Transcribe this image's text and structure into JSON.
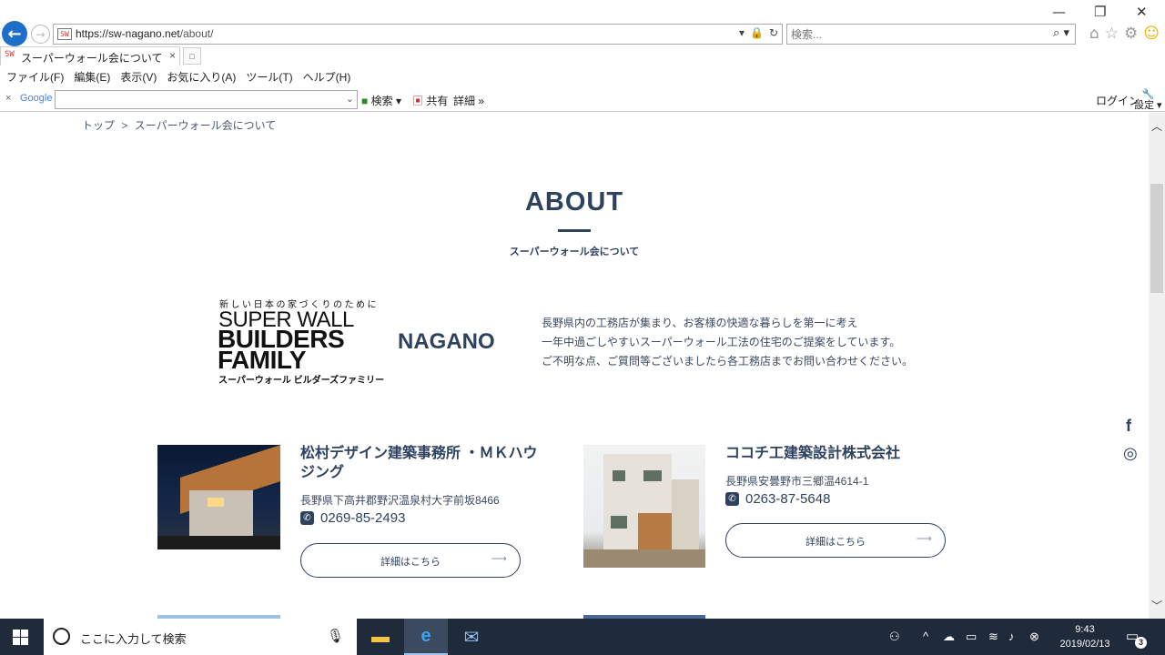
{
  "browser": {
    "url_host": "https://sw-nagano.net",
    "url_path": "/about/",
    "search_placeholder": "検索...",
    "tab_title": "スーパーウォール会について | 長野...",
    "menu": [
      "ファイル(F)",
      "編集(E)",
      "表示(V)",
      "お気に入り(A)",
      "ツール(T)",
      "ヘルプ(H)"
    ],
    "google_bar": {
      "logo": "Google",
      "search_label": "検索",
      "share_label": "共有",
      "more_label": "詳細",
      "login_label": "ログイン",
      "settings_label": "設定"
    }
  },
  "page": {
    "breadcrumb": {
      "home": "トップ",
      "separator": ">",
      "current": "スーパーウォール会について"
    },
    "title": "ABOUT",
    "subtitle": "スーパーウォール会について",
    "logo": {
      "tagline": "新しい日本の家づくりのために",
      "line1": "SUPER WALL",
      "line2": "BUILDERS",
      "line3": "FAMILY",
      "kana": "スーパーウォール ビルダーズファミリー",
      "region": "NAGANO"
    },
    "intro": [
      "長野県内の工務店が集まり、お客様の快適な暮らしを第一に考え",
      "一年中過ごしやすいスーパーウォール工法の住宅のご提案をしています。",
      "ご不明な点、ご質問等ございましたら各工務店までお問い合わせください。"
    ],
    "cards": [
      {
        "name_line1": "松村デザイン建築事務所 ・ＭＫハウ",
        "name_line2": "ジング",
        "address": "長野県下高井郡野沢温泉村大字前坂8466",
        "tel": "0269-85-2493",
        "button": "詳細はこちら"
      },
      {
        "name_line1": "ココチ工建築設計株式会社",
        "name_line2": "",
        "address": "長野県安曇野市三郷温4614-1",
        "tel": "0263-87-5648",
        "button": "詳細はこちら"
      }
    ],
    "social": {
      "facebook": "f",
      "instagram": "◎"
    }
  },
  "taskbar": {
    "search_placeholder": "ここに入力して検索",
    "time": "9:43",
    "date": "2019/02/13",
    "notification_count": "3"
  },
  "colors": {
    "brand": "#2e4260",
    "taskbar": "#1f2a3a",
    "ie_blue": "#1e6fc8"
  }
}
